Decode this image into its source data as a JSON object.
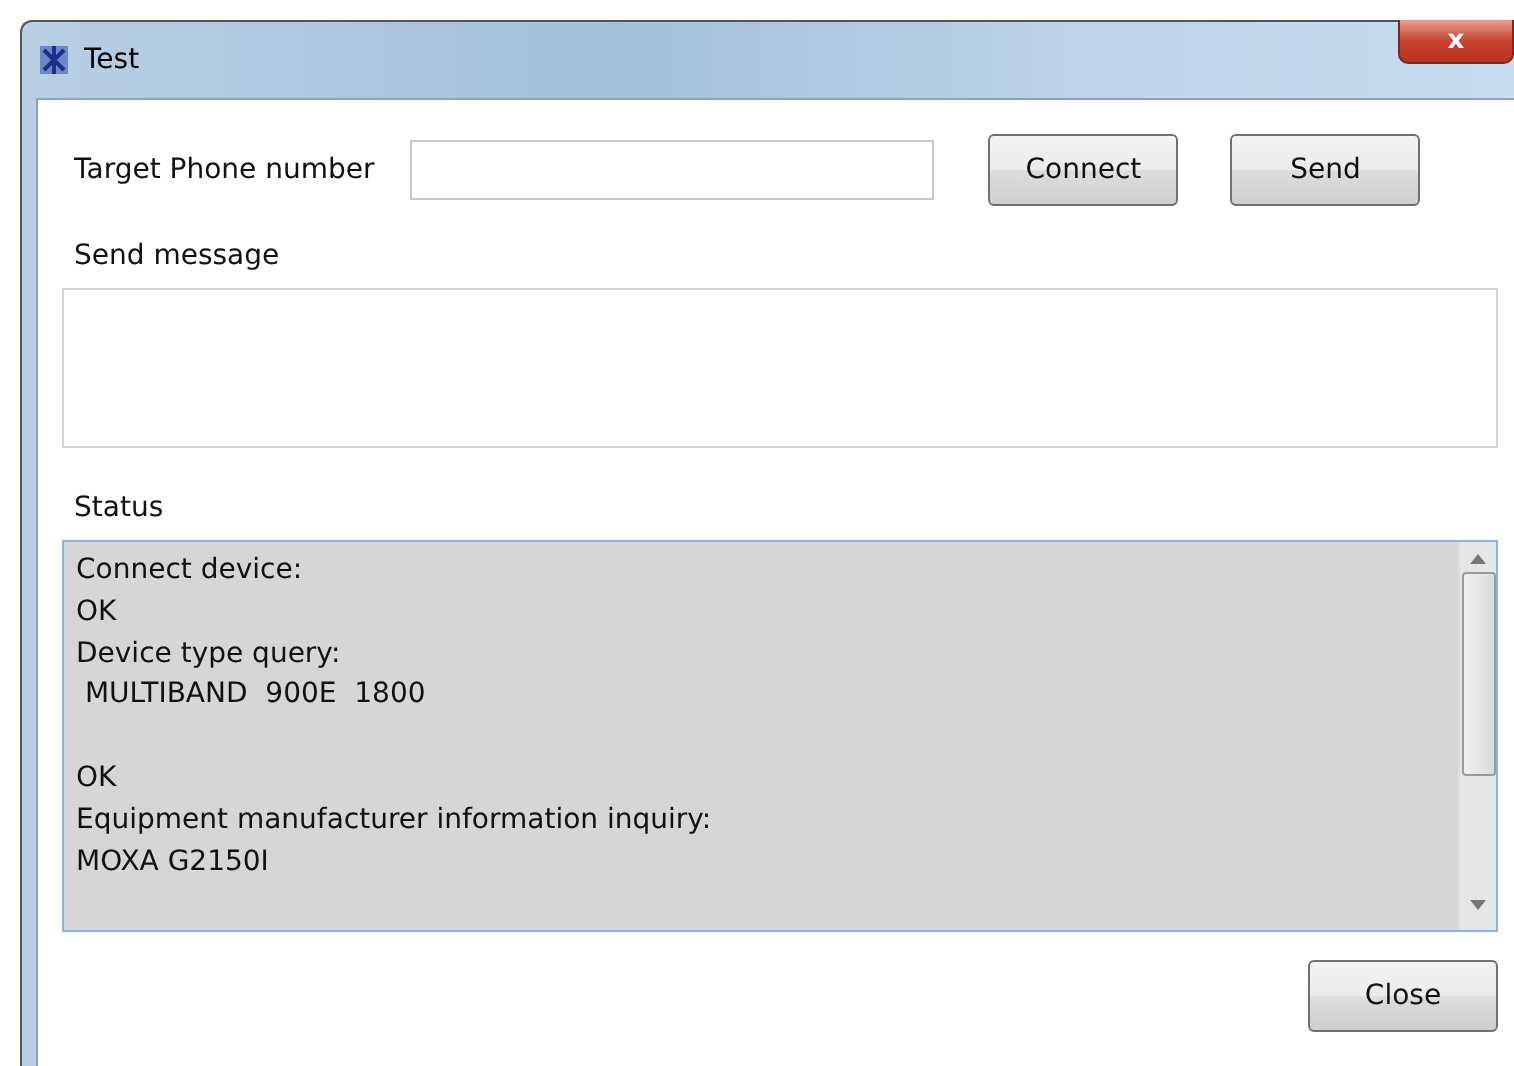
{
  "window": {
    "title": "Test",
    "close": "x"
  },
  "target": {
    "label": "Target Phone number"
  },
  "buttons": [
    {
      "label": "Connect"
    },
    {
      "label": "Send"
    }
  ],
  "send_message": {
    "label": "Send message"
  },
  "status": {
    "label": "Status",
    "text": "Connect device:\nOK\nDevice type query:\n MULTIBAND  900E  1800\n\nOK\nEquipment manufacturer information inquiry:\nMOXA G2150I"
  },
  "footer_button": "Close"
}
